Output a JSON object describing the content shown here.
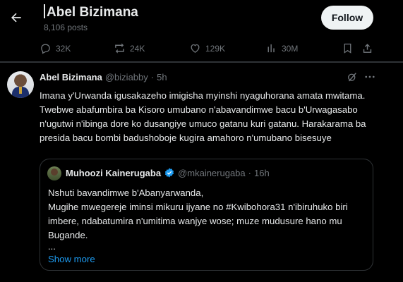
{
  "header": {
    "title": "Abel Bizimana",
    "posts_count": "8,106 posts",
    "follow_label": "Follow"
  },
  "actions": {
    "replies": "32K",
    "reposts": "24K",
    "likes": "129K",
    "views": "30M"
  },
  "tweet": {
    "author_name": "Abel Bizimana",
    "author_handle": "@biziabby",
    "separator": "·",
    "time": "5h",
    "text": "Imana y'Urwanda igusakazeho imigisha myinshi nyaguhorana amata mwitama. Twebwe abafumbira ba Kisoro umubano n'abavandimwe bacu b'Urwagasabo n'ugutwi n'ibinga dore ko dusangiye umuco gatanu kuri gatanu. Harakarama ba presida bacu bombi badushoboje kugira amahoro n'umubano bisesuye"
  },
  "quote": {
    "author_name": "Muhoozi Kainerugaba",
    "author_handle": "@mkainerugaba",
    "separator": "·",
    "time": "16h",
    "line1": "Nshuti bavandimwe b'Abanyarwanda,",
    "line2": "Mugihe mwegereje iminsi mikuru ijyane no #Kwibohora31 n'ibiruhuko biri imbere, ndabatumira n'umitima wanjye wose; muze mudusure hano mu Bugande.",
    "ellipsis": "...",
    "show_more": "Show more"
  },
  "colors": {
    "background": "#000000",
    "text": "#e7e9ea",
    "muted": "#71767b",
    "accent": "#1d9bf0",
    "border": "#2f3336",
    "follow_bg": "#eff3f4"
  },
  "icons": [
    "back-arrow-icon",
    "reply-icon",
    "repost-icon",
    "like-icon",
    "views-icon",
    "bookmark-icon",
    "share-icon",
    "grok-icon",
    "more-icon",
    "verified-icon"
  ]
}
